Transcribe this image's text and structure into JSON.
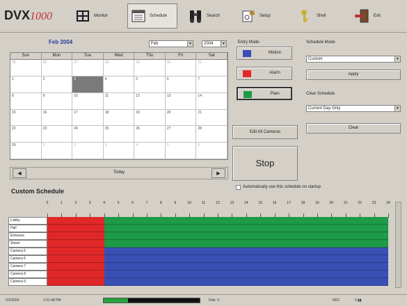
{
  "brand": {
    "dvx": "DVX",
    "model": "1000"
  },
  "toolbar": [
    {
      "label": "Monitor",
      "icon": "monitor-grid-icon"
    },
    {
      "label": "Schedule",
      "icon": "calendar-icon"
    },
    {
      "label": "Search",
      "icon": "binoculars-icon"
    },
    {
      "label": "Setup",
      "icon": "setup-icon"
    },
    {
      "label": "Shell",
      "icon": "key-icon"
    },
    {
      "label": "Exit",
      "icon": "exit-door-icon"
    }
  ],
  "calendar": {
    "title": "Feb 2004",
    "month_select": "Feb",
    "year_select": "2004",
    "weekdays": [
      "Sun",
      "Mon",
      "Tue",
      "Wed",
      "Thu",
      "Fri",
      "Sat"
    ],
    "weeks": [
      [
        "25",
        "26",
        "27",
        "28",
        "29",
        "30",
        "31"
      ],
      [
        "1",
        "2",
        "3",
        "4",
        "5",
        "6",
        "7"
      ],
      [
        "8",
        "9",
        "10",
        "11",
        "12",
        "13",
        "14"
      ],
      [
        "15",
        "16",
        "17",
        "18",
        "19",
        "20",
        "21"
      ],
      [
        "22",
        "23",
        "24",
        "25",
        "26",
        "27",
        "28"
      ],
      [
        "29",
        "1",
        "2",
        "3",
        "4",
        "5",
        "6"
      ]
    ],
    "today_label": "Today",
    "prev": "◄",
    "next": "►"
  },
  "entry_mode": {
    "title": "Entry Mode",
    "items": [
      {
        "label": "Motion",
        "color": "#3a4fb4"
      },
      {
        "label": "Alarm",
        "color": "#e02828"
      },
      {
        "label": "Plain",
        "color": "#1e9a48"
      }
    ],
    "edit_all": "Edit All Cameras",
    "stop": "Stop"
  },
  "schedule_mode": {
    "title": "Schedule Mode",
    "value": "Custom",
    "apply": "Apply"
  },
  "clear_schedule": {
    "title": "Clear Schedule",
    "value": "Current Day Only",
    "clear": "Clear"
  },
  "auto_checkbox": "Automatically use this schedule on startup",
  "custom": {
    "title": "Custom Schedule",
    "hours": [
      "0",
      "1",
      "2",
      "3",
      "4",
      "5",
      "6",
      "7",
      "8",
      "9",
      "10",
      "11",
      "12",
      "13",
      "14",
      "15",
      "16",
      "17",
      "18",
      "19",
      "20",
      "21",
      "22",
      "23",
      "24"
    ],
    "rows": [
      {
        "label": "Lobby",
        "segs": [
          {
            "from": 0,
            "to": 4,
            "mode": "alarm"
          },
          {
            "from": 4,
            "to": 24,
            "mode": "plain"
          }
        ]
      },
      {
        "label": "Hall",
        "segs": [
          {
            "from": 0,
            "to": 4,
            "mode": "alarm"
          },
          {
            "from": 4,
            "to": 24,
            "mode": "plain"
          }
        ]
      },
      {
        "label": "Entrance",
        "segs": [
          {
            "from": 0,
            "to": 4,
            "mode": "alarm"
          },
          {
            "from": 4,
            "to": 24,
            "mode": "plain"
          }
        ]
      },
      {
        "label": "Street",
        "segs": [
          {
            "from": 0,
            "to": 4,
            "mode": "alarm"
          },
          {
            "from": 4,
            "to": 24,
            "mode": "plain"
          }
        ]
      },
      {
        "label": "Camera 5",
        "segs": [
          {
            "from": 0,
            "to": 4,
            "mode": "alarm"
          },
          {
            "from": 4,
            "to": 24,
            "mode": "motion"
          }
        ]
      },
      {
        "label": "Camera 6",
        "segs": [
          {
            "from": 0,
            "to": 4,
            "mode": "alarm"
          },
          {
            "from": 4,
            "to": 24,
            "mode": "motion"
          }
        ]
      },
      {
        "label": "Camera 7",
        "segs": [
          {
            "from": 0,
            "to": 4,
            "mode": "alarm"
          },
          {
            "from": 4,
            "to": 24,
            "mode": "motion"
          }
        ]
      },
      {
        "label": "Camera 8",
        "segs": [
          {
            "from": 0,
            "to": 4,
            "mode": "alarm"
          },
          {
            "from": 4,
            "to": 24,
            "mode": "motion"
          }
        ]
      },
      {
        "label": "Camera 9",
        "segs": [
          {
            "from": 0,
            "to": 4,
            "mode": "alarm"
          },
          {
            "from": 4,
            "to": 24,
            "mode": "motion"
          }
        ]
      }
    ],
    "colors": {
      "alarm": "#e02828",
      "plain": "#1e9a48",
      "motion": "#3a4fb4"
    }
  },
  "status": {
    "date": "2/3/2004",
    "time": "1:01:48 PM",
    "meter_level": 0.25,
    "disk": "Disk: 0",
    "rec": "REC",
    "indicator": "0 ▮▮"
  }
}
